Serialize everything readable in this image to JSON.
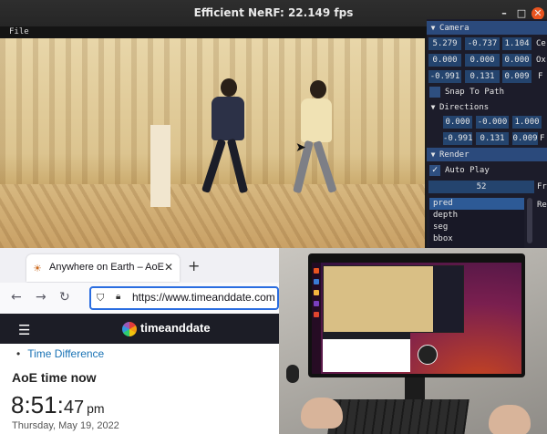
{
  "window": {
    "title": "Efficient NeRF: 22.149 fps"
  },
  "menu": {
    "file": "File"
  },
  "panel": {
    "camera": {
      "header": "Camera",
      "rows": [
        {
          "values": [
            "5.279",
            "-0.737",
            "1.104"
          ],
          "label": "Ce"
        },
        {
          "values": [
            "0.000",
            "0.000",
            "0.000"
          ],
          "label": "Ox"
        },
        {
          "values": [
            "-0.991",
            "0.131",
            "0.009"
          ],
          "label": "F"
        }
      ],
      "snap_to_path": "Snap To Path",
      "directions": {
        "header": "Directions",
        "rows": [
          {
            "values": [
              "0.000",
              "-0.000",
              "1.000"
            ],
            "label": ""
          },
          {
            "values": [
              "-0.991",
              "0.131",
              "0.009"
            ],
            "label": "F"
          }
        ]
      }
    },
    "render": {
      "header": "Render",
      "auto_play": "Auto Play",
      "auto_play_checked": true,
      "frame_value": "52",
      "frame_label": "Fr",
      "modes": [
        "pred",
        "depth",
        "seg",
        "bbox"
      ],
      "selected_mode": "pred",
      "list_label": "Re"
    }
  },
  "browser": {
    "tab_title": "Anywhere on Earth – AoE",
    "new_tab": "+",
    "url": "https://www.timeanddate.com",
    "site_name": "timeanddate",
    "link": "Time Difference",
    "heading": "AoE time now",
    "time": {
      "hm": "8:51:",
      "seconds": "47",
      "ampm": "pm"
    },
    "date": "Thursday, May 19, 2022"
  },
  "icons": {
    "minimize": "minimize-icon",
    "maximize": "maximize-icon",
    "close": "close-icon",
    "back": "back-arrow-icon",
    "forward": "forward-arrow-icon",
    "reload": "reload-icon",
    "shield": "shield-icon",
    "lock": "lock-icon",
    "menu": "hamburger-menu-icon"
  }
}
